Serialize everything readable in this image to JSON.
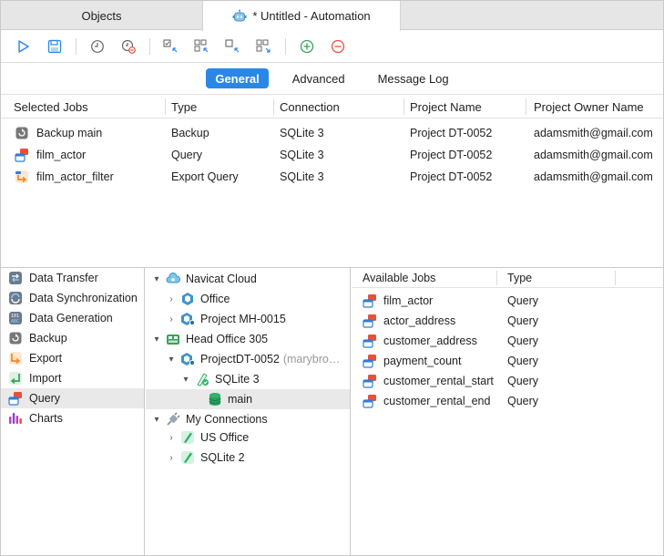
{
  "tabs": {
    "objects": "Objects",
    "active": "* Untitled - Automation"
  },
  "toolbar": {
    "buttons": [
      "run-icon",
      "save-icon",
      "schedule-icon",
      "delete-schedule-icon",
      "select-icon",
      "select-all-icon",
      "deselect-icon",
      "deselect-all-icon",
      "add-icon",
      "remove-icon"
    ]
  },
  "segments": {
    "general": "General",
    "advanced": "Advanced",
    "message_log": "Message Log"
  },
  "jobs": {
    "headers": [
      "Selected Jobs",
      "Type",
      "Connection",
      "Project Name",
      "Project Owner Name"
    ],
    "rows": [
      {
        "name": "Backup main",
        "type": "Backup",
        "connection": "SQLite 3",
        "project": "Project DT-0052",
        "owner": "adamsmith@gmail.com",
        "icon": "backup-icon"
      },
      {
        "name": "film_actor",
        "type": "Query",
        "connection": "SQLite 3",
        "project": "Project DT-0052",
        "owner": "adamsmith@gmail.com",
        "icon": "query-icon"
      },
      {
        "name": "film_actor_filter",
        "type": "Export Query",
        "connection": "SQLite 3",
        "project": "Project DT-0052",
        "owner": "adamsmith@gmail.com",
        "icon": "export-query-icon"
      }
    ]
  },
  "categories": [
    {
      "label": "Data Transfer",
      "icon": "data-transfer-icon"
    },
    {
      "label": "Data Synchronization",
      "icon": "data-sync-icon"
    },
    {
      "label": "Data Generation",
      "icon": "data-generation-icon"
    },
    {
      "label": "Backup",
      "icon": "backup-icon"
    },
    {
      "label": "Export",
      "icon": "export-icon"
    },
    {
      "label": "Import",
      "icon": "import-icon"
    },
    {
      "label": "Query",
      "icon": "query-icon",
      "selected": true
    },
    {
      "label": "Charts",
      "icon": "charts-icon"
    }
  ],
  "tree": {
    "navicat_cloud": "Navicat Cloud",
    "office": "Office",
    "project_mh": "Project MH-0015",
    "head_office": "Head Office 305",
    "project_dt": "ProjectDT-0052",
    "project_dt_owner": "(marybro…",
    "sqlite3": "SQLite 3",
    "main": "main",
    "my_connections": "My Connections",
    "us_office": "US Office",
    "sqlite2": "SQLite 2"
  },
  "available": {
    "headers": [
      "Available Jobs",
      "Type"
    ],
    "rows": [
      {
        "name": "film_actor",
        "type": "Query"
      },
      {
        "name": "actor_address",
        "type": "Query"
      },
      {
        "name": "customer_address",
        "type": "Query"
      },
      {
        "name": "payment_count",
        "type": "Query"
      },
      {
        "name": "customer_rental_start",
        "type": "Query"
      },
      {
        "name": "customer_rental_end",
        "type": "Query"
      }
    ]
  },
  "colors": {
    "accent": "#2a87e8",
    "selection": "#e9e9e9",
    "query_red": "#e8503a",
    "query_blue": "#2f7ed8",
    "export_orange": "#f08a24",
    "import_green": "#3aa35a",
    "sqlite_green": "#2fb26a"
  }
}
